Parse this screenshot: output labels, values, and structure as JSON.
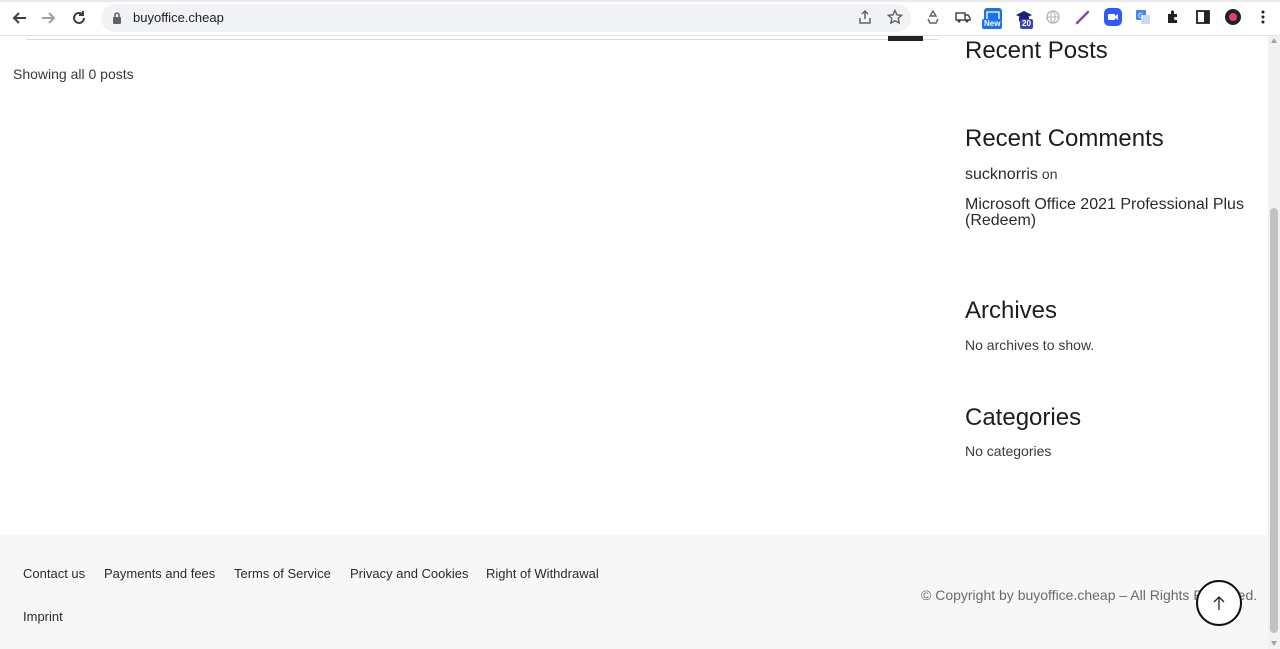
{
  "browser": {
    "url": "buyoffice.cheap",
    "extensions": [
      {
        "name": "recycle-extension-icon",
        "color": "#5f6368"
      },
      {
        "name": "truck-extension-icon",
        "color": "#3c4043"
      },
      {
        "name": "new-badge-extension-icon",
        "color": "#1a73e8",
        "badge": "New"
      },
      {
        "name": "graduation-cap-extension-icon",
        "color": "#1a237e",
        "badge": "20"
      },
      {
        "name": "globe-extension-icon",
        "color": "#b0b0b0"
      },
      {
        "name": "pen-extension-icon",
        "color": "#8e44ad"
      },
      {
        "name": "video-extension-icon",
        "color": "#2d5bff"
      },
      {
        "name": "translate-extension-icon",
        "color": "#4285f4"
      },
      {
        "name": "puzzle-extensions-icon",
        "color": "#202124"
      },
      {
        "name": "side-panel-icon",
        "color": "#202124"
      },
      {
        "name": "profile-avatar-icon",
        "color": "#202124"
      },
      {
        "name": "kebab-menu-icon",
        "color": "#202124"
      }
    ]
  },
  "main": {
    "showing": "Showing all 0 posts"
  },
  "sidebar": {
    "recent_posts_title": "Recent Posts",
    "recent_comments_title": "Recent Comments",
    "comment_author": "sucknorris",
    "comment_on": "on",
    "comment_post": "Microsoft Office 2021 Professional Plus (Redeem)",
    "archives_title": "Archives",
    "archives_empty": "No archives to show.",
    "categories_title": "Categories",
    "categories_empty": "No categories"
  },
  "footer": {
    "links": [
      "Contact us",
      "Payments and fees",
      "Terms of Service",
      "Privacy and Cookies",
      "Right of Withdrawal",
      "Imprint"
    ],
    "copyright": "© Copyright by buyoffice.cheap – All Rights Reserved."
  }
}
